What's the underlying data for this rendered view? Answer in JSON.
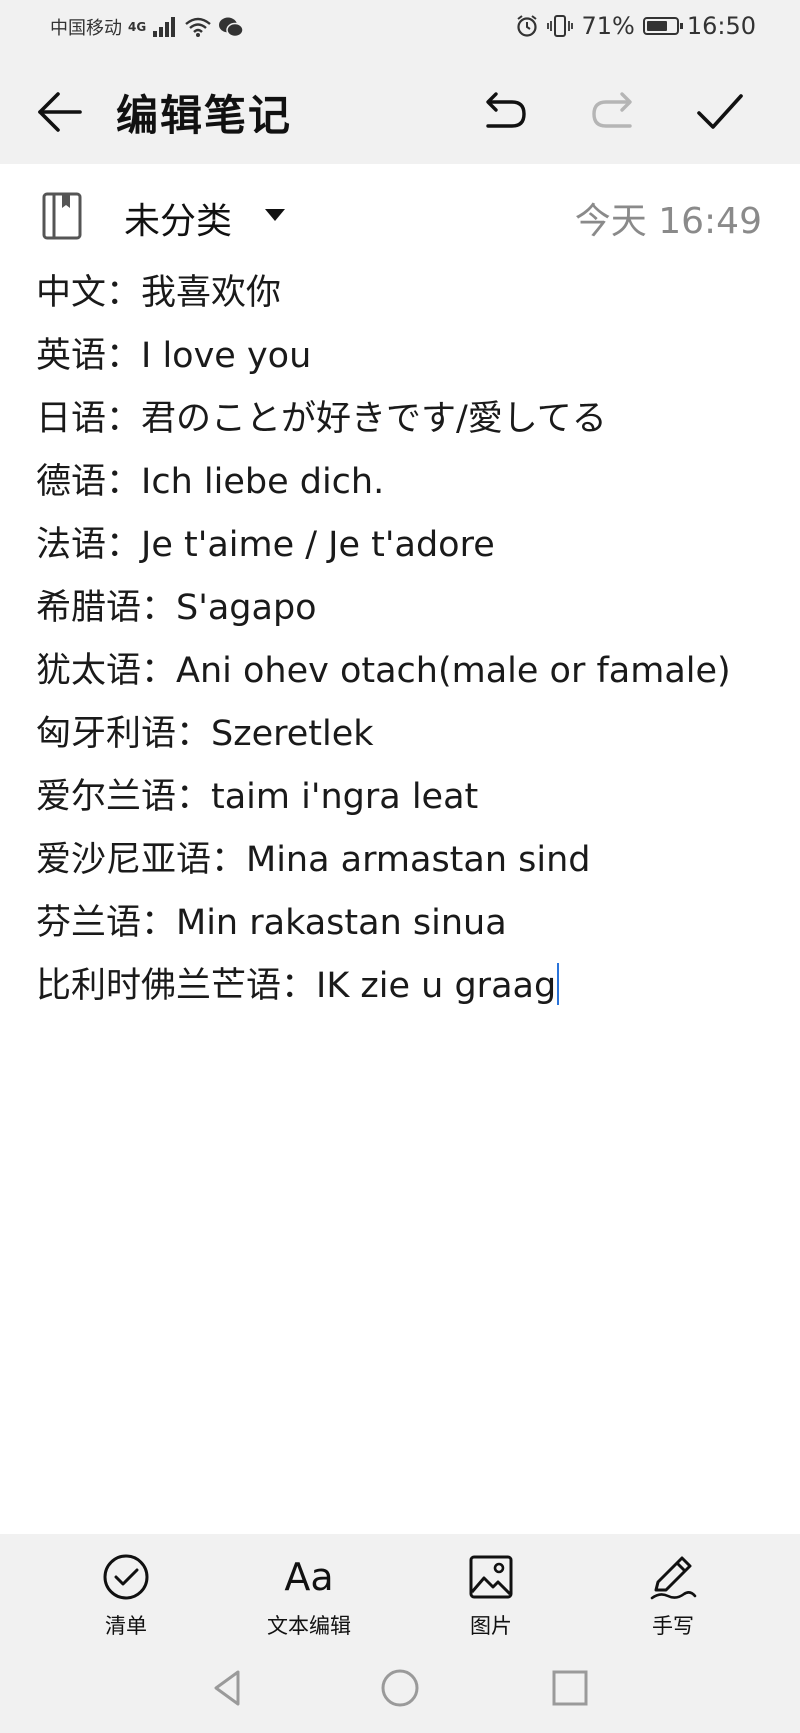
{
  "status_bar": {
    "carrier": "中国移动",
    "network": "4G",
    "battery": "71%",
    "battery_level": 0.71,
    "time": "16:50"
  },
  "app_bar": {
    "title": "编辑笔记"
  },
  "note": {
    "category": "未分类",
    "date": "今天 16:49",
    "lines": [
      "中文：我喜欢你",
      "英语：I love you",
      "日语：君のことが好きです/愛してる",
      "德语：Ich liebe dich.",
      "法语：Je t'aime / Je t'adore",
      "希腊语：S'agapo",
      "犹太语：Ani ohev otach(male or famale)",
      "匈牙利语：Szeretlek",
      "爱尔兰语：taim i'ngra leat",
      "爱沙尼亚语：Mina armastan sind",
      "芬兰语：Min rakastan sinua",
      "比利时佛兰芒语：IK zie u graag"
    ]
  },
  "toolbar": {
    "checklist": "清单",
    "text_edit_glyph": "Aa",
    "text_edit": "文本编辑",
    "image": "图片",
    "handwrite": "手写"
  },
  "icons": {
    "back": "arrow-left-icon",
    "undo": "undo-icon",
    "redo": "redo-icon",
    "done": "check-icon",
    "book": "notebook-icon",
    "caret": "caret-down-icon",
    "checklist": "circle-check-icon",
    "image": "image-icon",
    "handwrite": "pen-icon",
    "nav_back": "triangle-back-icon",
    "nav_home": "circle-home-icon",
    "nav_recent": "square-recent-icon"
  },
  "colors": {
    "bar_background": "#f1f1f1",
    "cursor": "#2a73d9",
    "date_text": "#8a8a8a",
    "disabled_icon": "#b5b5b5"
  }
}
